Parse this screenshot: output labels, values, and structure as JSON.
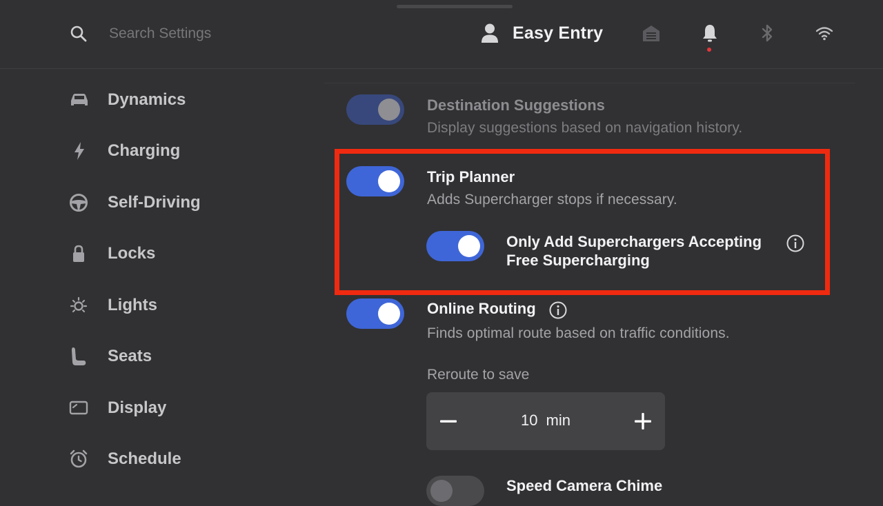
{
  "header": {
    "search_placeholder": "Search Settings",
    "profile_name": "Easy Entry",
    "icons": [
      "search-icon",
      "user-icon",
      "garage-icon",
      "bell-icon",
      "bluetooth-icon",
      "wifi-icon"
    ],
    "notification_dot_color": "#e3373a"
  },
  "sidebar": {
    "items": [
      {
        "label": "Dynamics",
        "icon": "car-icon"
      },
      {
        "label": "Charging",
        "icon": "bolt-icon"
      },
      {
        "label": "Self-Driving",
        "icon": "steering-wheel-icon"
      },
      {
        "label": "Locks",
        "icon": "lock-icon"
      },
      {
        "label": "Lights",
        "icon": "sun-icon"
      },
      {
        "label": "Seats",
        "icon": "seat-icon"
      },
      {
        "label": "Display",
        "icon": "display-icon"
      },
      {
        "label": "Schedule",
        "icon": "alarm-clock-icon"
      }
    ]
  },
  "settings": {
    "destination_suggestions": {
      "title": "Destination Suggestions",
      "description": "Display suggestions based on navigation history.",
      "enabled": true
    },
    "trip_planner": {
      "title": "Trip Planner",
      "description": "Adds Supercharger stops if necessary.",
      "enabled": true,
      "sub_option": {
        "title_line1": "Only Add Superchargers Accepting",
        "title_line2": "Free Supercharging",
        "enabled": true
      }
    },
    "online_routing": {
      "title": "Online Routing",
      "description": "Finds optimal route based on traffic conditions.",
      "enabled": true
    },
    "reroute": {
      "label": "Reroute to save",
      "value": "10 min"
    },
    "speed_camera_chime": {
      "title": "Speed Camera Chime",
      "enabled": false
    }
  },
  "colors": {
    "background": "#313133",
    "toggle_on": "#3f66d8",
    "highlight": "#f02a10"
  }
}
